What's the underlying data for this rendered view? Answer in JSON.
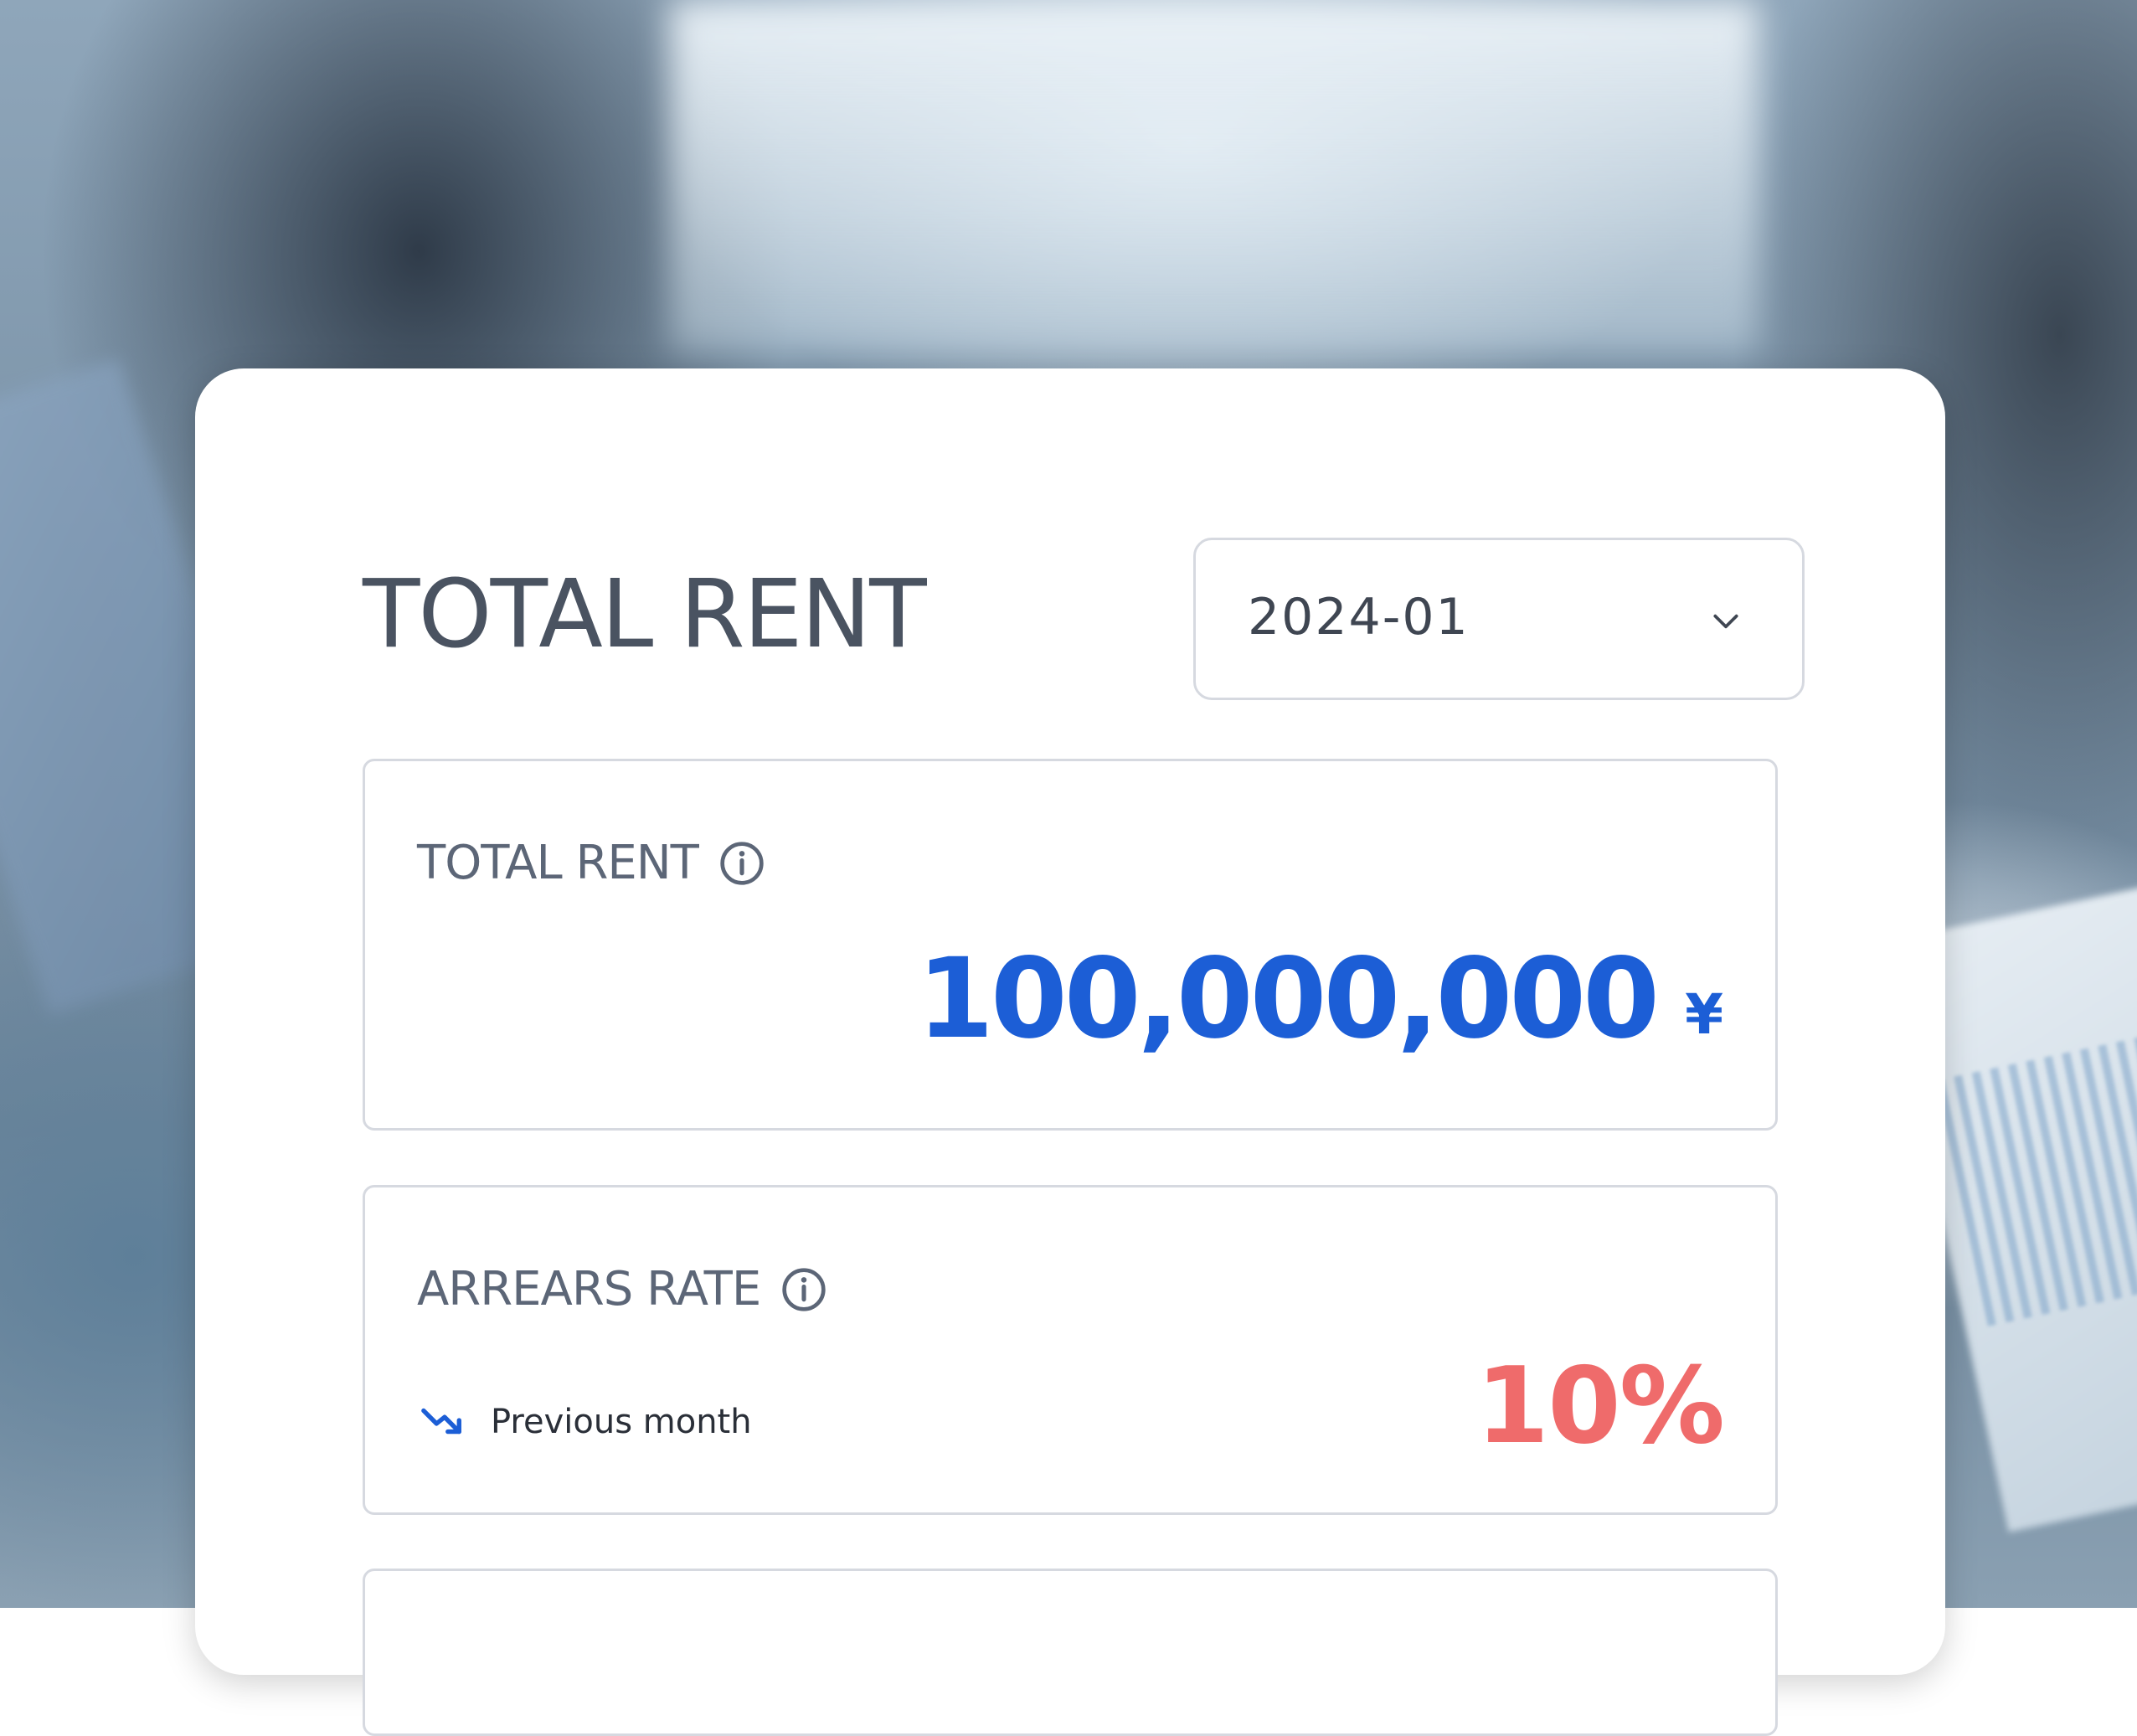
{
  "header": {
    "title": "TOTAL RENT"
  },
  "period_select": {
    "value": "2024-01",
    "icon": "chevron-down-icon"
  },
  "cards": {
    "total_rent": {
      "label": "TOTAL RENT",
      "icon": "info-icon",
      "amount": "100,000,000",
      "currency": "¥",
      "color": "#1c5ed6"
    },
    "arrears_rate": {
      "label": "ARREARS RATE",
      "icon": "info-icon",
      "trend_icon": "trending-down-icon",
      "trend_label": "Previous month",
      "value": "10%",
      "color": "#ef6b6b"
    }
  }
}
